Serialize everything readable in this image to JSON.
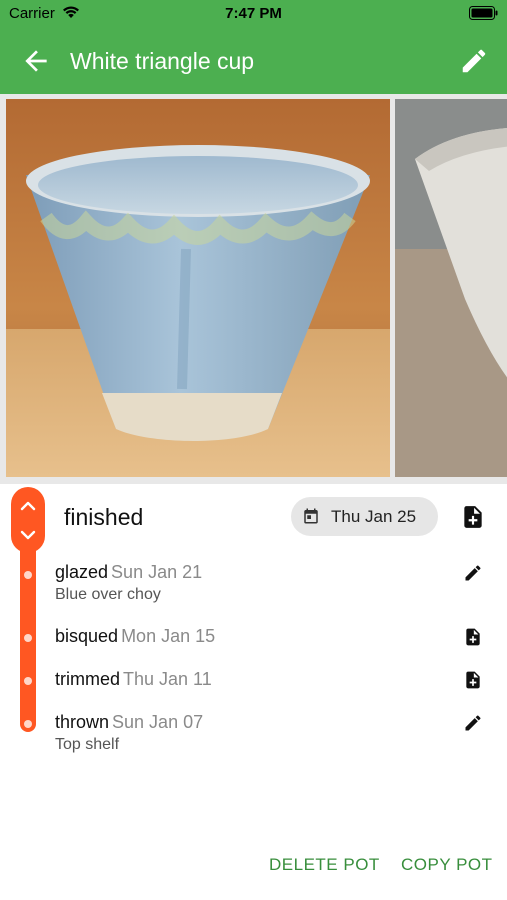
{
  "status_bar": {
    "carrier": "Carrier",
    "time": "7:47 PM"
  },
  "app_bar": {
    "title": "White triangle cup"
  },
  "current": {
    "status": "finished",
    "date": "Thu Jan 25"
  },
  "history": [
    {
      "status": "glazed",
      "date": "Sun Jan 21",
      "note": "Blue over choy",
      "action_icon": "pencil-icon"
    },
    {
      "status": "bisqued",
      "date": "Mon Jan 15",
      "note": "",
      "action_icon": "note-add-icon"
    },
    {
      "status": "trimmed",
      "date": "Thu Jan 11",
      "note": "",
      "action_icon": "note-add-icon"
    },
    {
      "status": "thrown",
      "date": "Sun Jan 07",
      "note": "Top shelf",
      "action_icon": "pencil-icon"
    }
  ],
  "footer": {
    "delete_label": "DELETE POT",
    "copy_label": "COPY POT"
  },
  "colors": {
    "primary": "#4caf50",
    "accent": "#ff5722",
    "button_text": "#388e3c"
  }
}
